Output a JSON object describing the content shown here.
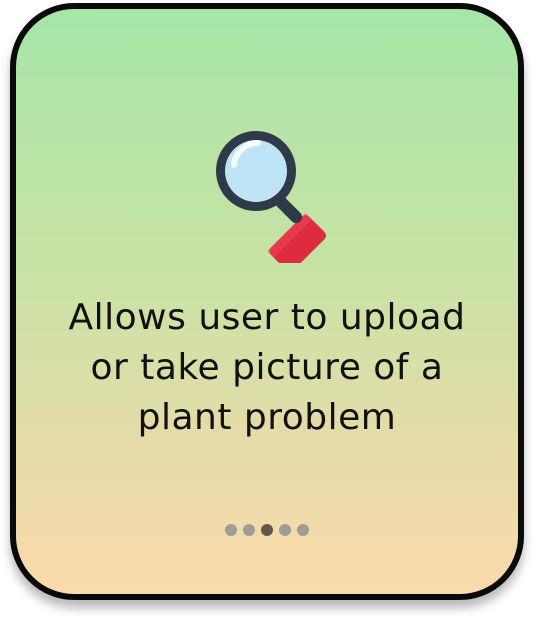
{
  "card": {
    "icon": "magnifying-glass-icon",
    "caption": "Allows user to upload or take picture of a plant problem"
  },
  "pager": {
    "total": 5,
    "active_index": 2
  },
  "colors": {
    "gradient_top": "#a6e6a7",
    "gradient_bottom": "#fbdaab",
    "border": "#0a0a0a",
    "dot_inactive": "#9d9d95",
    "dot_active": "#5e5a4e",
    "handle_red": "#dc2c3d"
  }
}
